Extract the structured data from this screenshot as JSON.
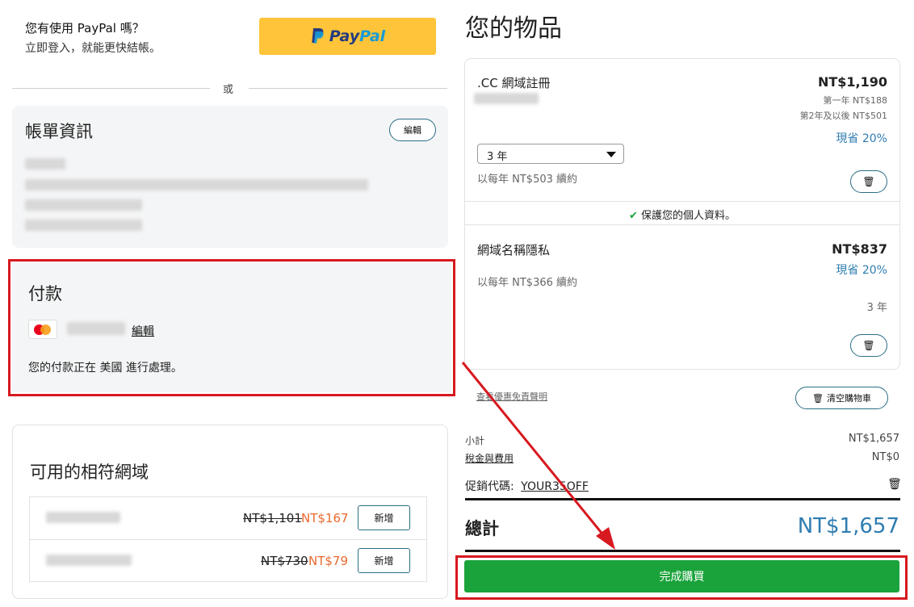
{
  "paypal": {
    "question": "您有使用 PayPal 嗎？",
    "subtext": "立即登入，就能更快結帳。",
    "button_pay": "Pay",
    "button_pal": "Pal",
    "divider": "或",
    "brand_color": "#ffc439"
  },
  "billing": {
    "title": "帳單資訊",
    "edit_label": "編輯"
  },
  "payment": {
    "title": "付款",
    "edit_link": "編輯",
    "processing_text": "您的付款正在 美國 進行處理。"
  },
  "suggestions": {
    "title": "可用的相符網域",
    "add_label": "新增",
    "items": [
      {
        "old_price": "NT$1,101",
        "new_price": "NT$167"
      },
      {
        "old_price": "NT$730",
        "new_price": "NT$79"
      }
    ]
  },
  "cart": {
    "title": "您的物品",
    "item1": {
      "name": ".CC 網域註冊",
      "price": "NT$1,190",
      "first_year": "第一年 NT$188",
      "later_years": "第2年及以後 NT$501",
      "savings": "現省 20%",
      "term": "3 年",
      "renew": "以每年 NT$503 續約"
    },
    "protect_notice": "保護您的個人資料。",
    "item2": {
      "name": "網域名稱隱私",
      "price": "NT$837",
      "savings": "現省 20%",
      "renew": "以每年 NT$366 續約",
      "term": "3 年"
    },
    "disclaimer_link": "查看優惠免責聲明",
    "clear_cart": "清空購物車"
  },
  "summary": {
    "subtotal_label": "小計",
    "subtotal_value": "NT$1,657",
    "tax_label": "稅金與費用",
    "tax_value": "NT$0",
    "promo_label": "促銷代碼:",
    "promo_code": "YOUR35OFF",
    "total_label": "總計",
    "total_value": "NT$1,657",
    "checkout_label": "完成購買",
    "checkout_color": "#1aa33a"
  }
}
